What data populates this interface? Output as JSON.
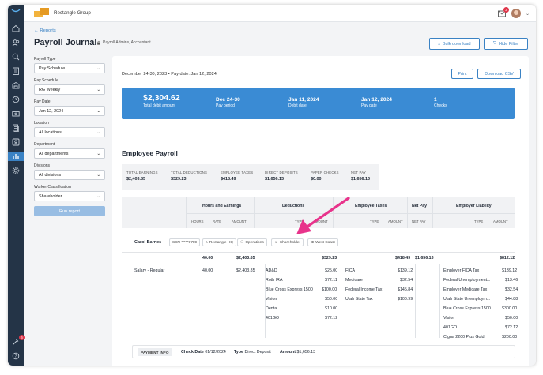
{
  "org": {
    "name": "Rectangle Group"
  },
  "notifications": {
    "count": "2"
  },
  "rail": {
    "help_badge": "6"
  },
  "header": {
    "back_label": "Reports",
    "title": "Payroll Journal",
    "permissions": "Payroll Admins, Accountant",
    "bulk_download": "Bulk download",
    "hide_filter": "Hide Filter"
  },
  "filters": [
    {
      "label": "Payroll Type",
      "value": "Pay Schedule"
    },
    {
      "label": "Pay Schedule",
      "value": "RG Weekly"
    },
    {
      "label": "Pay Date",
      "value": "Jan 12, 2024"
    },
    {
      "label": "Location",
      "value": "All locations"
    },
    {
      "label": "Department",
      "value": "All departments"
    },
    {
      "label": "Divisions",
      "value": "All divisions"
    },
    {
      "label": "Worker Classification",
      "value": "Shareholder"
    }
  ],
  "run_report": "Run report",
  "report": {
    "period": "December 24-30, 2023  •  Pay date: Jan 12, 2024",
    "print": "Print",
    "download_csv": "Download CSV"
  },
  "summary": {
    "total_value": "$2,304.62",
    "total_label": "Total debit amount",
    "items": [
      {
        "value": "Dec 24-30",
        "label": "Pay period"
      },
      {
        "value": "Jan 11, 2024",
        "label": "Debit date"
      },
      {
        "value": "Jan 12, 2024",
        "label": "Pay date"
      },
      {
        "value": "1",
        "label": "Checks"
      }
    ]
  },
  "employee_payroll": {
    "title": "Employee Payroll",
    "totals": [
      {
        "label": "TOTAL EARNINGS",
        "value": "$2,403.85"
      },
      {
        "label": "TOTAL DEDUCTIONS",
        "value": "$329.23"
      },
      {
        "label": "EMPLOYEE TAXES",
        "value": "$418.49"
      },
      {
        "label": "DIRECT DEPOSITS",
        "value": "$1,656.13"
      },
      {
        "label": "PAPER CHECKS",
        "value": "$0.00"
      },
      {
        "label": "NET PAY",
        "value": "$1,656.13"
      }
    ]
  },
  "table": {
    "groups": {
      "hours": "Hours and Earnings",
      "deductions": "Deductions",
      "taxes": "Employee Taxes",
      "net": "Net Pay",
      "liability": "Employer Liability"
    },
    "sub": {
      "hours": "HOURS",
      "rate": "RATE",
      "amount": "AMOUNT",
      "type": "TYPE",
      "net_pay": "NET PAY"
    }
  },
  "employee": {
    "name": "Carol Barnes",
    "ssn": "SSN *****9789",
    "location": "Rectangle HQ",
    "department": "Operations",
    "classification": "Shareholder",
    "division": "West Coast",
    "totals": {
      "hours": "40.00",
      "earnings": "$2,403.85",
      "deductions": "$329.23",
      "taxes": "$418.49",
      "net": "$1,656.13",
      "liability": "$812.12"
    },
    "earnings": [
      {
        "type": "Salary - Regular",
        "hours": "40.00",
        "amount": "$2,403.85"
      }
    ],
    "deductions": [
      {
        "type": "AD&D",
        "amount": "$25.00"
      },
      {
        "type": "Roth IRA",
        "amount": "$72.11"
      },
      {
        "type": "Blue Cross Express 1500",
        "amount": "$100.00"
      },
      {
        "type": "Vision",
        "amount": "$50.00"
      },
      {
        "type": "Dental",
        "amount": "$10.00"
      },
      {
        "type": "401GO",
        "amount": "$72.12"
      }
    ],
    "taxes": [
      {
        "type": "FICA",
        "amount": "$139.12"
      },
      {
        "type": "Medicare",
        "amount": "$32.54"
      },
      {
        "type": "Federal Income Tax",
        "amount": "$145.84"
      },
      {
        "type": "Utah State Tax",
        "amount": "$100.99"
      }
    ],
    "liability": [
      {
        "type": "Employer FICA Tax",
        "amount": "$139.12"
      },
      {
        "type": "Federal Unemployment...",
        "amount": "$13.46"
      },
      {
        "type": "Employer Medicare Tax",
        "amount": "$32.54"
      },
      {
        "type": "Utah State Unemploym...",
        "amount": "$44.88"
      },
      {
        "type": "Blue Cross Express 1500",
        "amount": "$300.00"
      },
      {
        "type": "Vision",
        "amount": "$50.00"
      },
      {
        "type": "401GO",
        "amount": "$72.12"
      },
      {
        "type": "Cigna 2200 Plus Gold",
        "amount": "$200.00"
      }
    ]
  },
  "payment_info": {
    "tag": "PAYMENT INFO",
    "check_date_label": "Check Date",
    "check_date": "01/12/2024",
    "type_label": "Type",
    "type": "Direct Deposit",
    "amount_label": "Amount",
    "amount": "$1,656.13"
  },
  "colors": {
    "rail": "#243447",
    "accent": "#3a82c4",
    "summary": "#3a8bd4",
    "annotation_arrow": "#e8338b"
  }
}
